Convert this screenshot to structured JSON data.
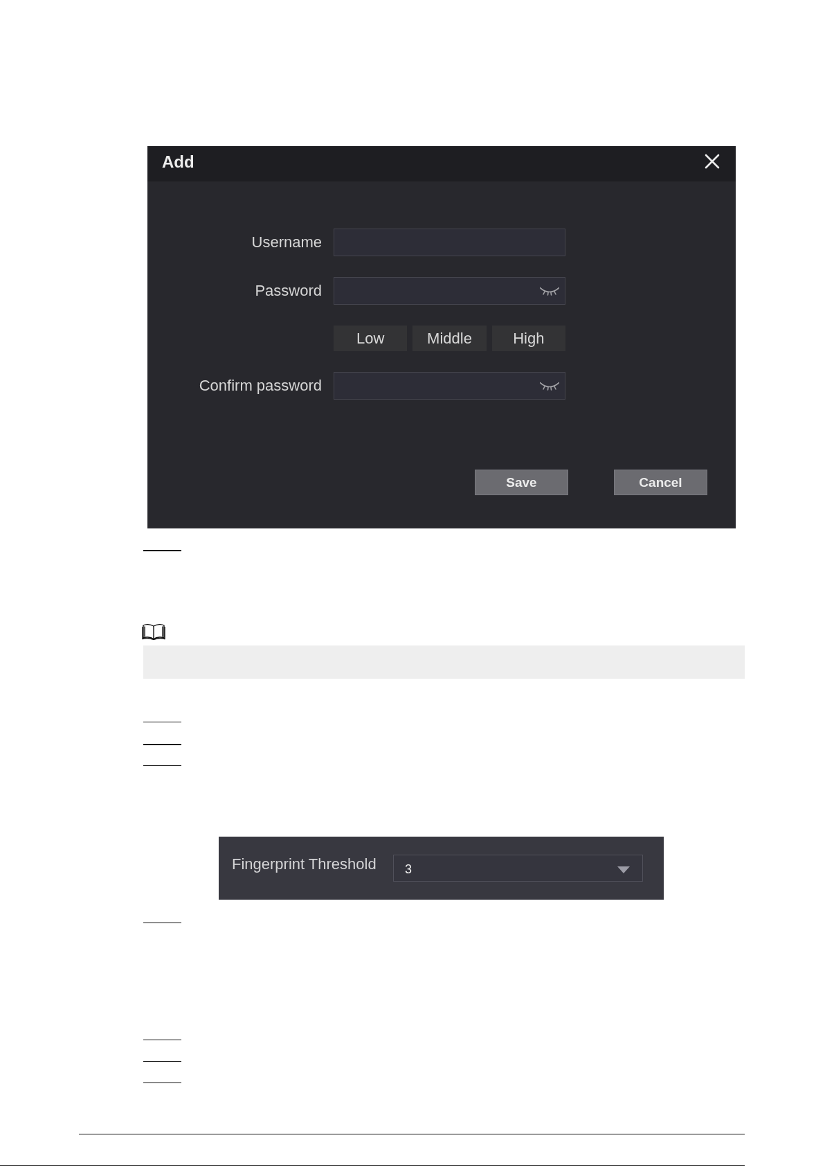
{
  "dialog": {
    "title": "Add",
    "fields": [
      {
        "kind": "text",
        "label": "Username"
      },
      {
        "kind": "password",
        "label": "Password"
      },
      {
        "kind": "strength",
        "levels": [
          "Low",
          "Middle",
          "High"
        ]
      },
      {
        "kind": "password",
        "label": "Confirm password"
      }
    ],
    "buttons": [
      "Save",
      "Cancel"
    ]
  },
  "threshold_panel": {
    "label": "Fingerprint Threshold",
    "value": "3"
  }
}
